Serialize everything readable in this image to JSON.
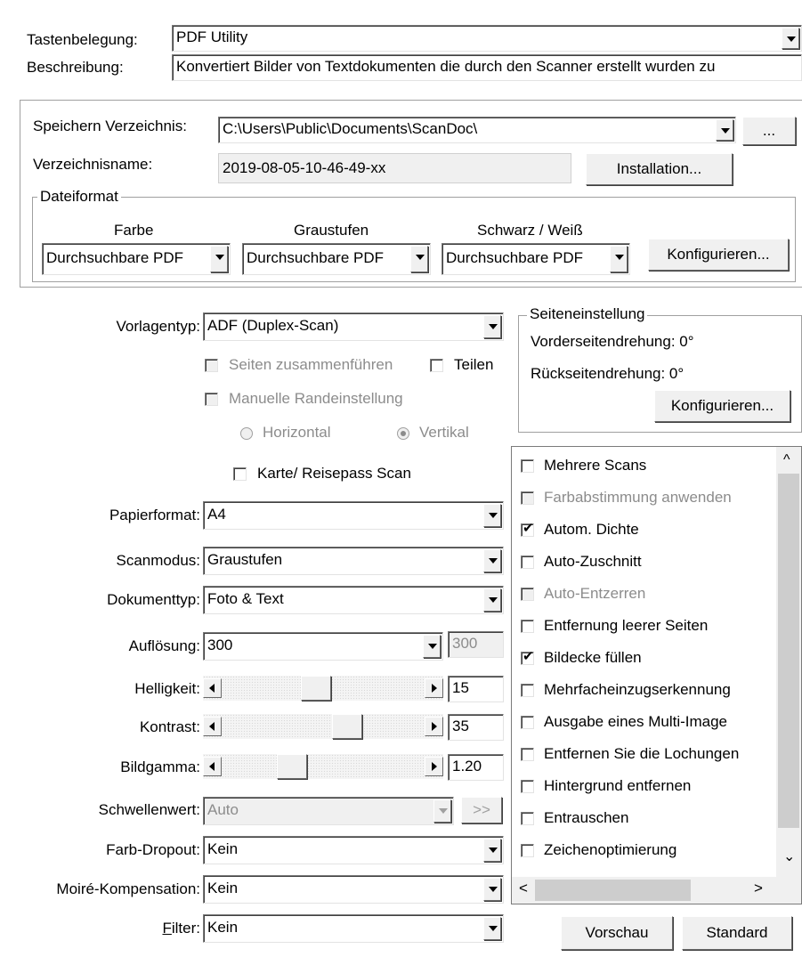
{
  "top": {
    "key_label": "Tastenbelegung:",
    "key_value": "PDF Utility",
    "desc_label": "Beschreibung:",
    "desc_value": "Konvertiert Bilder von Textdokumenten die durch den Scanner erstellt wurden  zu"
  },
  "save": {
    "dir_label": "Speichern Verzeichnis:",
    "dir_value": "C:\\Users\\Public\\Documents\\ScanDoc\\",
    "browse_label": "...",
    "name_label": "Verzeichnisname:",
    "name_value": "2019-08-05-10-46-49-xx",
    "install_label": "Installation..."
  },
  "file_format": {
    "group_title": "Dateiformat",
    "color_label": "Farbe",
    "gray_label": "Graustufen",
    "bw_label": "Schwarz / Weiß",
    "color_value": "Durchsuchbare PDF",
    "gray_value": "Durchsuchbare PDF",
    "bw_value": "Durchsuchbare PDF",
    "configure_label": "Konfigurieren..."
  },
  "template": {
    "label": "Vorlagentyp:",
    "value": "ADF (Duplex-Scan)",
    "merge_label": "Seiten zusammenführen",
    "split_label": "Teilen",
    "manual_margin_label": "Manuelle Randeinstellung",
    "horizontal_label": "Horizontal",
    "vertical_label": "Vertikal",
    "card_scan_label": "Karte/ Reisepass Scan"
  },
  "page_settings": {
    "group_title": "Seiteneinstellung",
    "front_rotation": "Vorderseitendrehung: 0°",
    "back_rotation": "Rückseitendrehung: 0°",
    "configure_label": "Konfigurieren..."
  },
  "fields": {
    "paper_label": "Papierformat:",
    "paper_value": "A4",
    "scanmode_label": "Scanmodus:",
    "scanmode_value": "Graustufen",
    "doctype_label": "Dokumenttyp:",
    "doctype_value": "Foto & Text",
    "resolution_label": "Auflösung:",
    "resolution_value": "300",
    "resolution_readout": "300",
    "brightness_label": "Helligkeit:",
    "brightness_value": "15",
    "contrast_label": "Kontrast:",
    "contrast_value": "35",
    "gamma_label": "Bildgamma:",
    "gamma_value": "1.20",
    "threshold_label": "Schwellenwert:",
    "threshold_value": "Auto",
    "threshold_more": ">>",
    "dropout_label": "Farb-Dropout:",
    "dropout_value": "Kein",
    "moire_label": "Moiré-Kompensation:",
    "moire_value": "Kein",
    "filter_label_prefix": "",
    "filter_label_ul": "F",
    "filter_label_rest": "ilter:",
    "filter_value": "Kein"
  },
  "options": [
    {
      "label": "Mehrere Scans",
      "checked": false,
      "disabled": false
    },
    {
      "label": "Farbabstimmung anwenden",
      "checked": false,
      "disabled": true
    },
    {
      "label": "Autom. Dichte",
      "checked": true,
      "disabled": false
    },
    {
      "label": "Auto-Zuschnitt",
      "checked": false,
      "disabled": false
    },
    {
      "label": "Auto-Entzerren",
      "checked": false,
      "disabled": true
    },
    {
      "label": "Entfernung leerer Seiten",
      "checked": false,
      "disabled": false
    },
    {
      "label": "Bildecke füllen",
      "checked": true,
      "disabled": false
    },
    {
      "label": "Mehrfacheinzugserkennung",
      "checked": false,
      "disabled": false
    },
    {
      "label": "Ausgabe eines Multi-Image",
      "checked": false,
      "disabled": false
    },
    {
      "label": "Entfernen Sie die Lochungen",
      "checked": false,
      "disabled": false
    },
    {
      "label": "Hintergrund entfernen",
      "checked": false,
      "disabled": false
    },
    {
      "label": "Entrauschen",
      "checked": false,
      "disabled": false
    },
    {
      "label": "Zeichenoptimierung",
      "checked": false,
      "disabled": false
    }
  ],
  "levels": {
    "brightness_fraction": 0.46,
    "contrast_fraction": 0.64,
    "gamma_fraction": 0.32
  },
  "buttons": {
    "preview_label": "Vorschau",
    "default_label": "Standard"
  },
  "glyphs": {
    "check": "✔",
    "scroll_up": "^",
    "scroll_down": "⌄",
    "scroll_left": "<",
    "scroll_right": ">"
  }
}
